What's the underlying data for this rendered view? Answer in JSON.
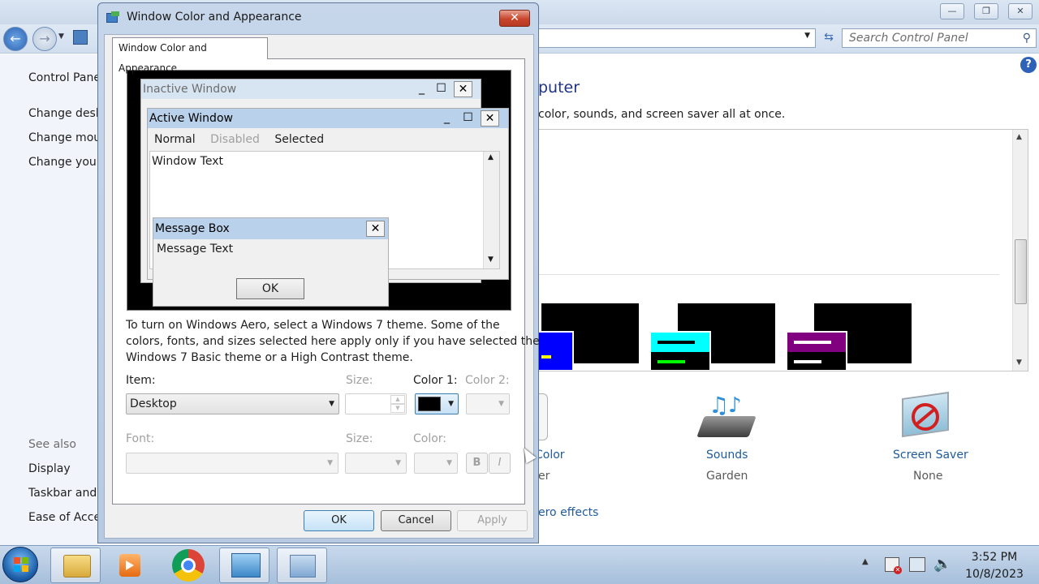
{
  "control_panel": {
    "search_placeholder": "Search Control Panel",
    "sidebar": {
      "home": "Control Panel",
      "links": [
        "Change desk",
        "Change mou",
        "Change your"
      ],
      "see_also_label": "See also",
      "see_also": [
        "Display",
        "Taskbar and",
        "Ease of Acce"
      ]
    },
    "heading": "puter",
    "description": "color, sounds, and screen saver all at once.",
    "bottom_items": {
      "color_label": "Color",
      "color_sub": "er",
      "sounds_label": "Sounds",
      "sounds_sub": "Garden",
      "screensaver_label": "Screen Saver",
      "screensaver_sub": "None"
    },
    "aero_link": "ero effects"
  },
  "dialog": {
    "title": "Window Color and Appearance",
    "tab_label": "Window Color and Appearance",
    "preview": {
      "inactive_title": "Inactive Window",
      "active_title": "Active Window",
      "menu_normal": "Normal",
      "menu_disabled": "Disabled",
      "menu_selected": "Selected",
      "window_text": "Window Text",
      "message_box_title": "Message Box",
      "message_text": "Message Text",
      "message_ok": "OK"
    },
    "info_text_1": "To turn on Windows Aero, select a Windows 7 theme.  Some of the",
    "info_text_2": "colors, fonts, and sizes selected here apply only if you have selected the",
    "info_text_3": "Windows 7 Basic theme or a High Contrast theme.",
    "item_label": "Item:",
    "item_value": "Desktop",
    "size_label": "Size:",
    "color1_label": "Color 1:",
    "color2_label": "Color 2:",
    "font_label": "Font:",
    "font_size_label": "Size:",
    "font_color_label": "Color:",
    "bold_label": "B",
    "italic_label": "I",
    "ok_label": "OK",
    "cancel_label": "Cancel",
    "apply_label": "Apply",
    "color1_value": "#000000"
  },
  "taskbar": {
    "time": "3:52 PM",
    "date": "10/8/2023"
  },
  "colors": {
    "active_title_bg": "#b9d1ea",
    "inactive_title_bg": "#d7e4f2",
    "theme_blue": "#0000ff",
    "theme_cyan": "#00ffff",
    "theme_purple": "#800080"
  }
}
